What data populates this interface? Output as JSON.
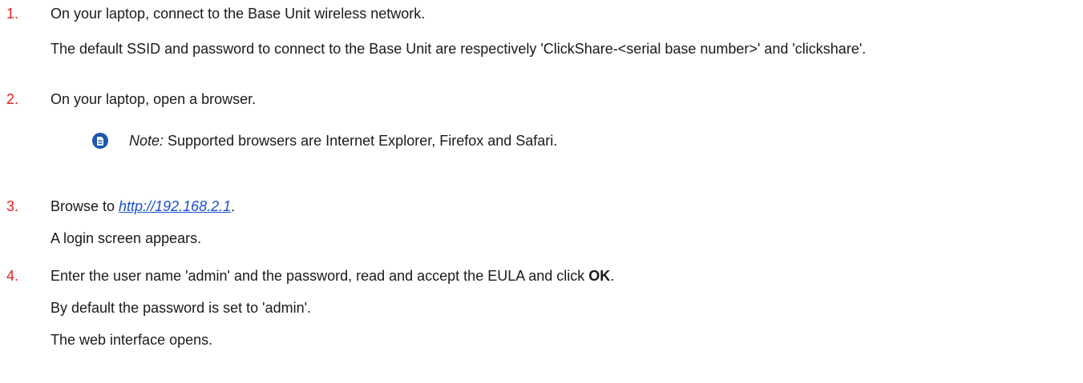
{
  "steps": [
    {
      "number": "1.",
      "text": "On your laptop, connect to the Base Unit wireless network.",
      "detail": "The default SSID and password to connect to the Base Unit are respectively 'ClickShare-<serial base number>' and 'clickshare'."
    },
    {
      "number": "2.",
      "text": "On your laptop, open a browser.",
      "note": {
        "label": "Note:",
        "text": " Supported browsers are Internet Explorer, Firefox and Safari."
      }
    },
    {
      "number": "3.",
      "text_before": "Browse to ",
      "link": "http://192.168.2.1",
      "text_after": ".",
      "result": "A login screen appears."
    },
    {
      "number": "4.",
      "text_before": "Enter the user name 'admin' and the password, read and accept the EULA and click ",
      "bold": "OK",
      "text_after": ".",
      "detail_1": "By default the password is set to 'admin'.",
      "detail_2": "The web interface opens."
    }
  ],
  "icons": {
    "note": "note-document-icon"
  },
  "colors": {
    "step_number": "#e8221c",
    "link": "#1b4fd1",
    "note_icon": "#1b56b0",
    "text": "#1a1a1a"
  }
}
